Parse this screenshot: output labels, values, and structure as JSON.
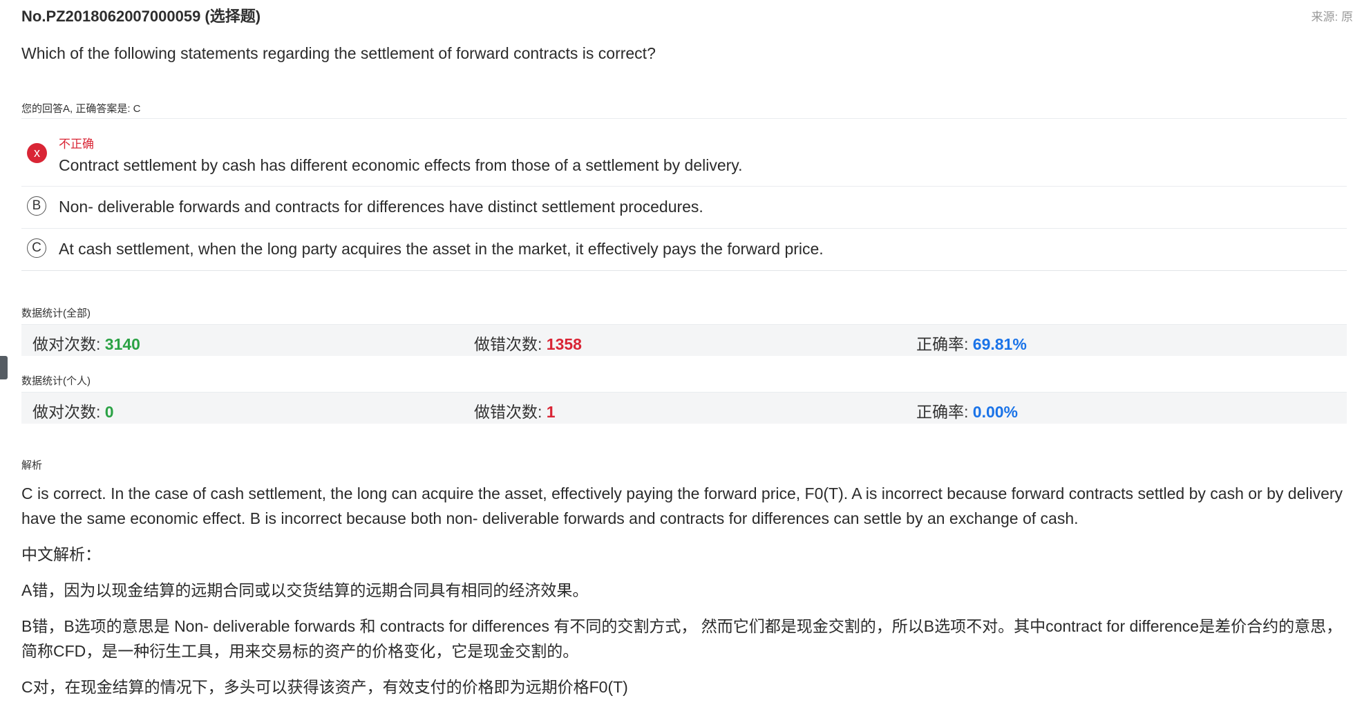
{
  "header": {
    "question_no": "No.PZ2018062007000059 (选择题)",
    "source": "来源: 原"
  },
  "question": {
    "text": "Which of the following statements regarding the settlement of forward contracts is correct?"
  },
  "answer_summary": "您的回答A, 正确答案是: C",
  "options": [
    {
      "badge": "x",
      "status": "不正确",
      "text": "Contract settlement by cash has different economic effects from those of a settlement by delivery."
    },
    {
      "badge": "B",
      "text": "Non- deliverable forwards and contracts for differences have distinct settlement procedures."
    },
    {
      "badge": "C",
      "text": "At cash settlement, when the long party acquires the asset in the market, it effectively pays the forward price."
    }
  ],
  "stats_all": {
    "label": "数据统计(全部)",
    "correct_label": "做对次数: ",
    "correct_value": "3140",
    "wrong_label": "做错次数: ",
    "wrong_value": "1358",
    "rate_label": "正确率: ",
    "rate_value": "69.81%"
  },
  "stats_personal": {
    "label": "数据统计(个人)",
    "correct_label": "做对次数: ",
    "correct_value": "0",
    "wrong_label": "做错次数: ",
    "wrong_value": "1",
    "rate_label": "正确率: ",
    "rate_value": "0.00%"
  },
  "analysis": {
    "label": "解析",
    "paragraphs": [
      "C is correct. In the case of cash settlement, the long can acquire the asset, effectively paying the forward price, F0(T). A is incorrect because forward contracts settled by cash or by delivery have the same economic effect. B is incorrect because both non- deliverable forwards and contracts for differences can settle by an exchange of cash.",
      "中文解析：",
      "A错，因为以现金结算的远期合同或以交货结算的远期合同具有相同的经济效果。",
      "B错，B选项的意思是 Non- deliverable forwards 和 contracts for differences 有不同的交割方式， 然而它们都是现金交割的，所以B选项不对。其中contract for difference是差价合约的意思，简称CFD，是一种衍生工具，用来交易标的资产的价格变化，它是现金交割的。",
      "C对，在现金结算的情况下，多头可以获得该资产，有效支付的价格即为远期价格F0(T)"
    ]
  },
  "colors": {
    "correct": "#2ba245",
    "wrong": "#d92535",
    "rate": "#1a73e8"
  }
}
